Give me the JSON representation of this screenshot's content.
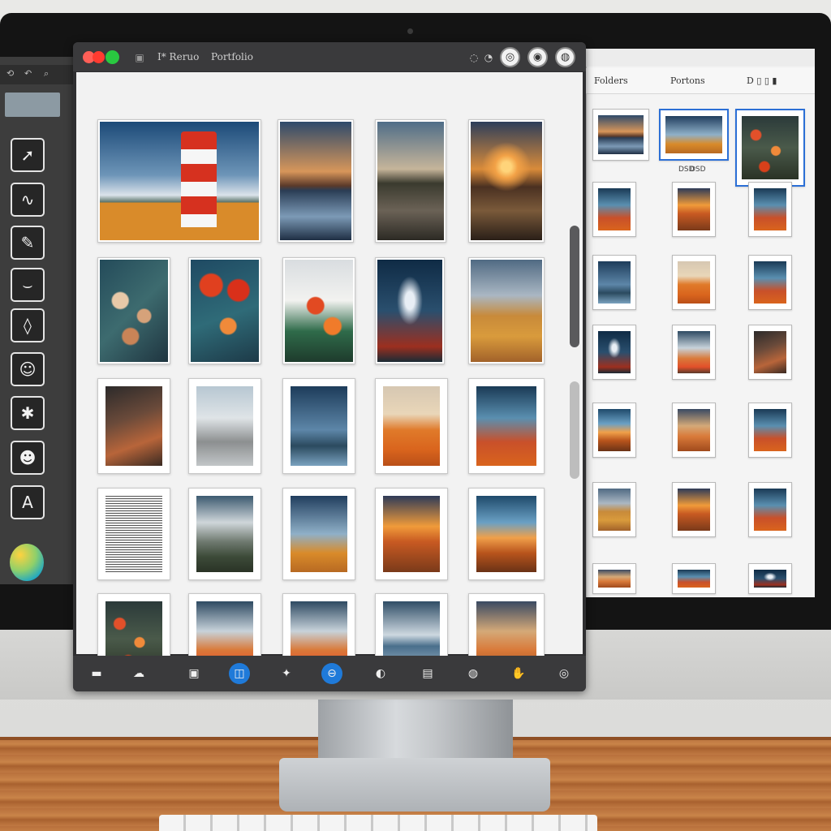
{
  "main_window": {
    "title": "Portfolio",
    "toolbar_title_prefix": "I* Reruo",
    "rows": [
      [
        "lighthouse",
        "sunset-lake",
        "road-a",
        "road-b"
      ],
      [
        "flowers-cream",
        "flowers-red",
        "flowers-white",
        "storm",
        "field-cloud"
      ],
      [
        "dark-orange",
        "misty",
        "small-lighthouse",
        "orange-field",
        "blue-field"
      ],
      [
        "lines",
        "mountain",
        "lh-field",
        "sunset-field",
        "blue-sunset"
      ],
      [
        "flower-mass",
        "dream-cloud",
        "dream-cloud",
        "ocean-cloud",
        "flow-sunset"
      ]
    ]
  },
  "right_panel": {
    "tab_left": "Folders",
    "tab_center": "Portons",
    "caption": "DSD"
  },
  "sidebar": {
    "top_labels": [
      "⟲",
      "↶",
      "🔍"
    ]
  },
  "colors": {
    "accent_blue": "#2b6fd6",
    "traffic_red": "#ff5f57",
    "traffic_green": "#29c940",
    "window_chrome": "#3a3a3c"
  },
  "icons": {
    "tools": [
      "select-tool-icon",
      "lasso-tool-icon",
      "hand-tool-icon",
      "brush-tool-icon",
      "crop-tool-icon",
      "face-tool-icon",
      "stamp-tool-icon",
      "emoji-tool-icon",
      "text-tool-icon"
    ],
    "dock": [
      "minus-icon",
      "cloud-icon",
      "image-icon",
      "folder-icon",
      "star-icon",
      "cloud-blue-icon",
      "face-icon",
      "archive-icon",
      "settings-icon",
      "hand-icon",
      "camera-icon"
    ]
  }
}
